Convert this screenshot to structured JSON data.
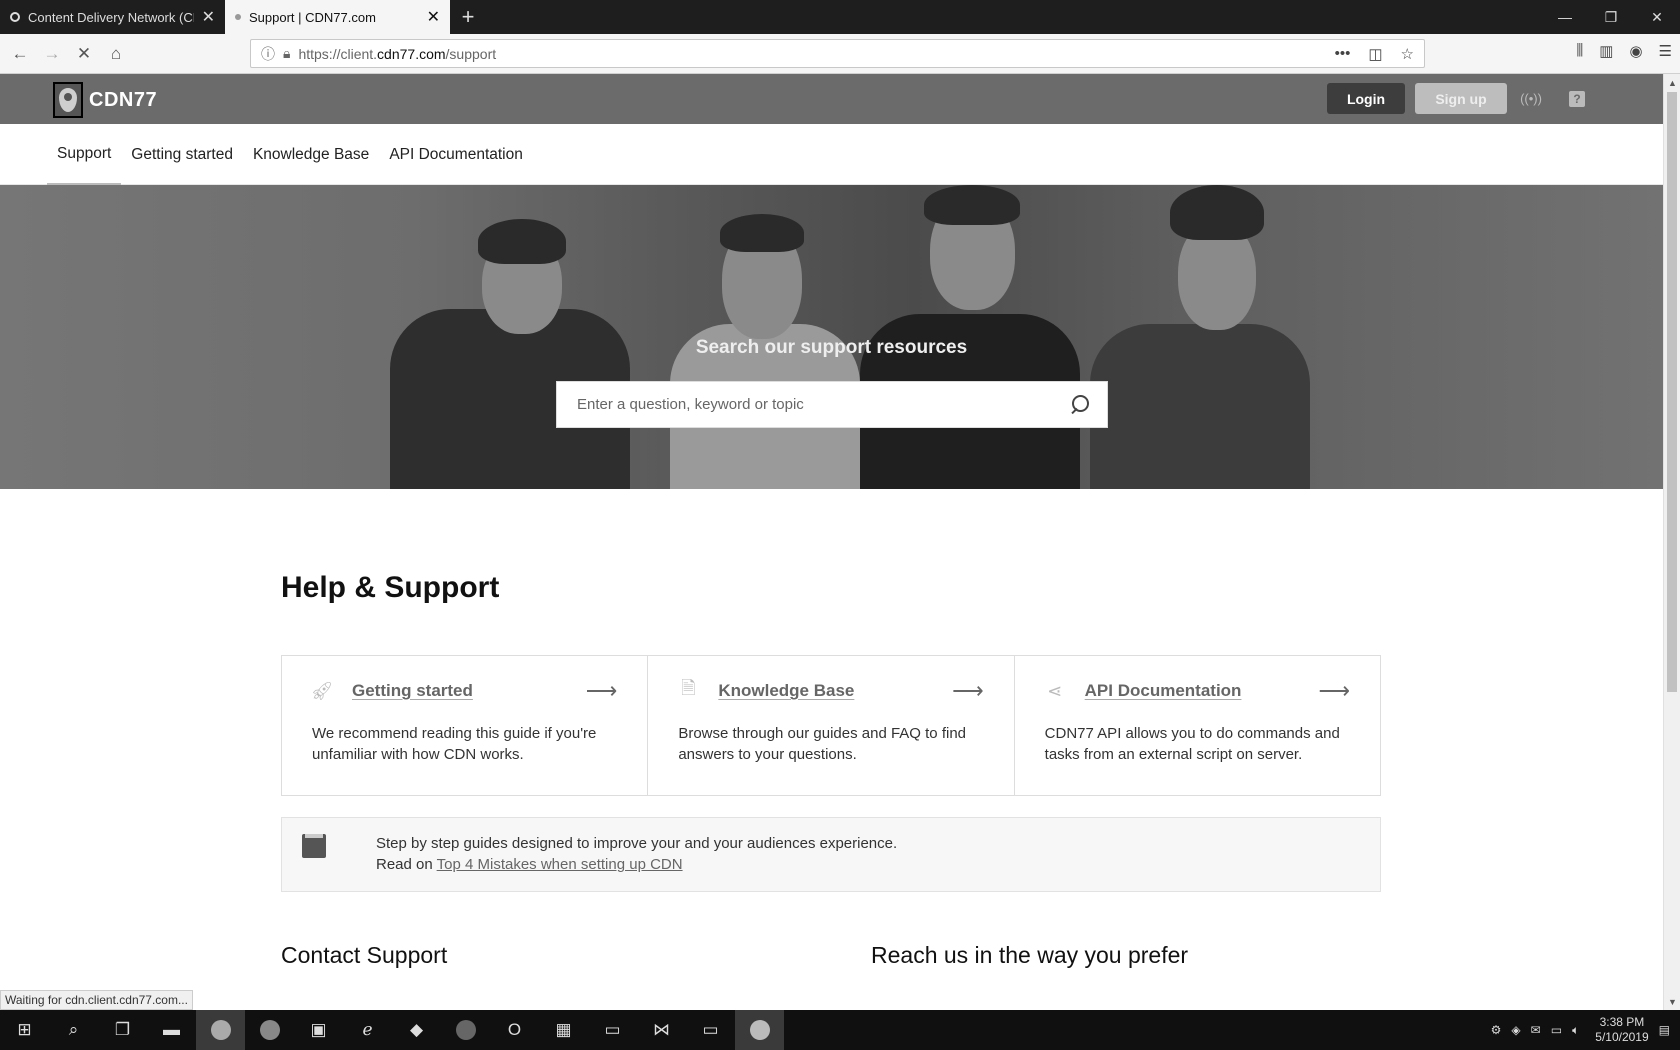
{
  "browser": {
    "tabs": [
      {
        "title": "Content Delivery Network (CDN)",
        "active": false
      },
      {
        "title": "Support | CDN77.com",
        "active": true
      }
    ],
    "url_prefix": "https://client.",
    "url_domain": "cdn77.com",
    "url_path": "/support",
    "status_text": "Waiting for cdn.client.cdn77.com..."
  },
  "site": {
    "logo_text": "CDN77",
    "login_label": "Login",
    "signup_label": "Sign up",
    "help_icon_label": "?",
    "nav": [
      {
        "label": "Support",
        "active": true
      },
      {
        "label": "Getting started"
      },
      {
        "label": "Knowledge Base"
      },
      {
        "label": "API Documentation"
      }
    ]
  },
  "hero": {
    "title": "Search our support resources",
    "search_placeholder": "Enter a question, keyword or topic"
  },
  "help": {
    "title": "Help & Support",
    "cards": [
      {
        "icon": "rocket-icon",
        "title": "Getting started",
        "desc": "We recommend reading this guide if you're unfamiliar with how CDN works."
      },
      {
        "icon": "document-icon",
        "title": "Knowledge Base",
        "desc": "Browse through our guides and FAQ to find answers to your questions."
      },
      {
        "icon": "share-icon",
        "title": "API Documentation",
        "desc": "CDN77 API allows you to do commands and tasks from an external script on server."
      }
    ],
    "guide_text": "Step by step guides designed to improve your and your audiences experience.",
    "guide_read_on": "Read on",
    "guide_link": "Top 4 Mistakes when setting up CDN"
  },
  "contact": {
    "left_title": "Contact Support",
    "right_title": "Reach us in the way you prefer"
  },
  "taskbar": {
    "time": "3:38 PM",
    "date": "5/10/2019"
  }
}
